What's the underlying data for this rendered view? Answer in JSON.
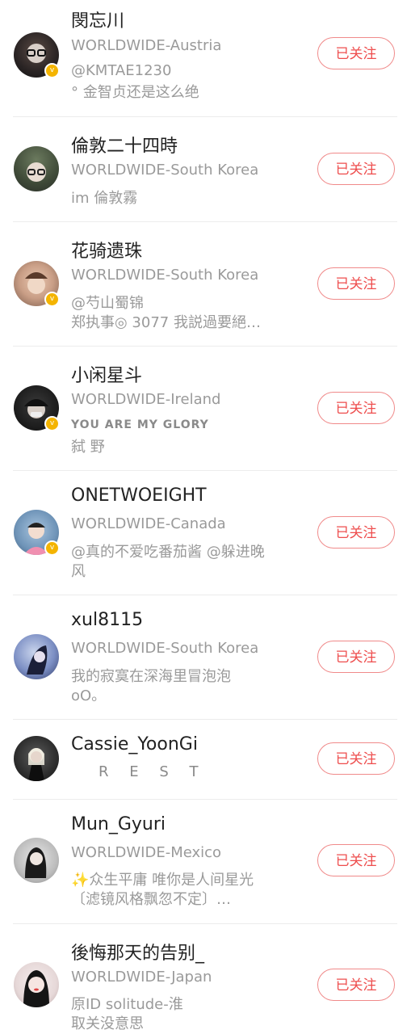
{
  "follow_label": "已关注",
  "users": [
    {
      "name": "閔忘川",
      "lines": [
        "WORLDWIDE-Austria",
        "@KMTAE1230",
        "°  金智贞还是这么绝"
      ],
      "verified": true
    },
    {
      "name": "倫敦二十四時",
      "lines": [
        "WORLDWIDE-South Korea",
        "im 倫敦霧"
      ],
      "verified": false
    },
    {
      "name": "花骑遗珠",
      "lines": [
        "WORLDWIDE-South Korea",
        "@芍山蜀锦",
        "郑执事◎ 3077 我説過要絕…"
      ],
      "verified": true
    },
    {
      "name": "小闲星斗",
      "lines": [
        "WORLDWIDE-Ireland",
        "YOU ARE MY GLORY",
        "弑 野"
      ],
      "verified": true
    },
    {
      "name": "ONETWOEIGHT",
      "lines": [
        "WORLDWIDE-Canada",
        "@真的不爱吃番茄酱 @躲进晚",
        "风"
      ],
      "verified": true
    },
    {
      "name": "xul8115",
      "lines": [
        "WORLDWIDE-South Korea",
        "我的寂寞在深海里冒泡泡",
        "oO。"
      ],
      "verified": false
    },
    {
      "name": "Cassie_YoonGi",
      "lines": [
        "R E S T"
      ],
      "verified": false
    },
    {
      "name": "Mun_Gyuri",
      "lines": [
        "WORLDWIDE-Mexico",
        "✨众生平庸 唯你是人间星光",
        "〔滤镜风格飘忽不定〕…"
      ],
      "verified": false
    },
    {
      "name": "後悔那天的告别_",
      "lines": [
        "WORLDWIDE-Japan",
        "原ID solitude-淮",
        "取关没意思"
      ],
      "verified": false
    }
  ]
}
